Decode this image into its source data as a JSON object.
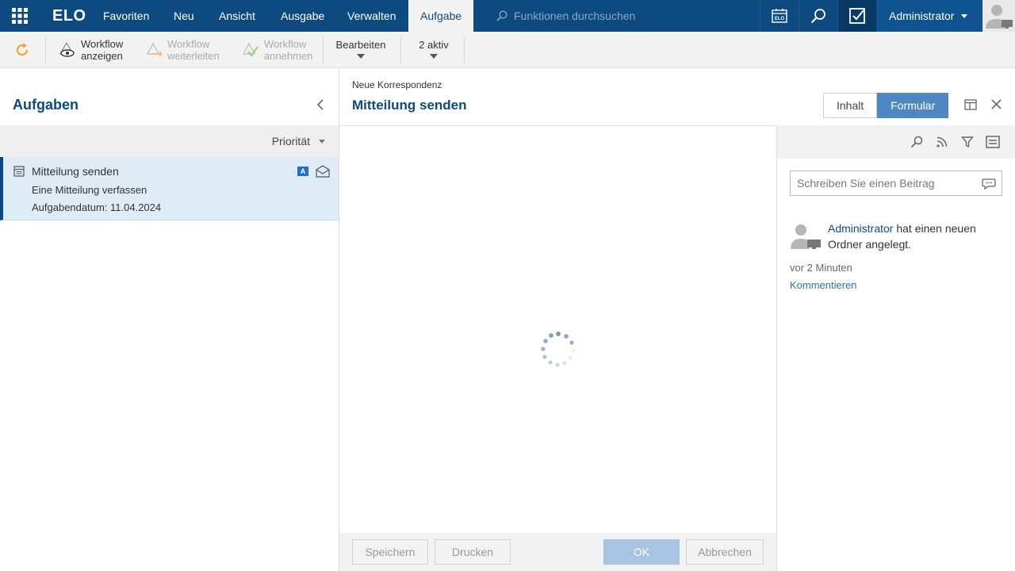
{
  "app": {
    "logo": "ELO"
  },
  "nav": {
    "items": [
      "Favoriten",
      "Neu",
      "Ansicht",
      "Ausgabe",
      "Verwalten",
      "Aufgabe"
    ],
    "active": "Aufgabe",
    "search_placeholder": "Funktionen durchsuchen",
    "user": "Administrator"
  },
  "toolbar": {
    "workflow_anzeigen": [
      "Workflow",
      "anzeigen"
    ],
    "workflow_weiterleiten": [
      "Workflow",
      "weiterleiten"
    ],
    "workflow_annehmen": [
      "Workflow",
      "annehmen"
    ],
    "bearbeiten": "Bearbeiten",
    "aktiv": "2 aktiv"
  },
  "left": {
    "title": "Aufgaben",
    "sort_label": "Priorität",
    "task": {
      "title": "Mitteilung senden",
      "description": "Eine Mitteilung verfassen",
      "date": "Aufgabendatum: 11.04.2024",
      "badge": "A"
    }
  },
  "center": {
    "subtitle": "Neue Korrespondenz",
    "title": "Mitteilung senden",
    "tabs": [
      "Inhalt",
      "Formular"
    ],
    "active_tab": "Formular",
    "footer": {
      "save": "Speichern",
      "print": "Drucken",
      "ok": "OK",
      "cancel": "Abbrechen"
    }
  },
  "feed": {
    "post_placeholder": "Schreiben Sie einen Beitrag",
    "entry": {
      "user": "Administrator",
      "text": " hat einen neuen Ordner angelegt.",
      "time": "vor 2 Minuten",
      "comment": "Kommentieren"
    }
  },
  "colors": {
    "primary": "#0d4a80",
    "accent": "#4e87c2",
    "selected_row": "#dfecf5"
  }
}
